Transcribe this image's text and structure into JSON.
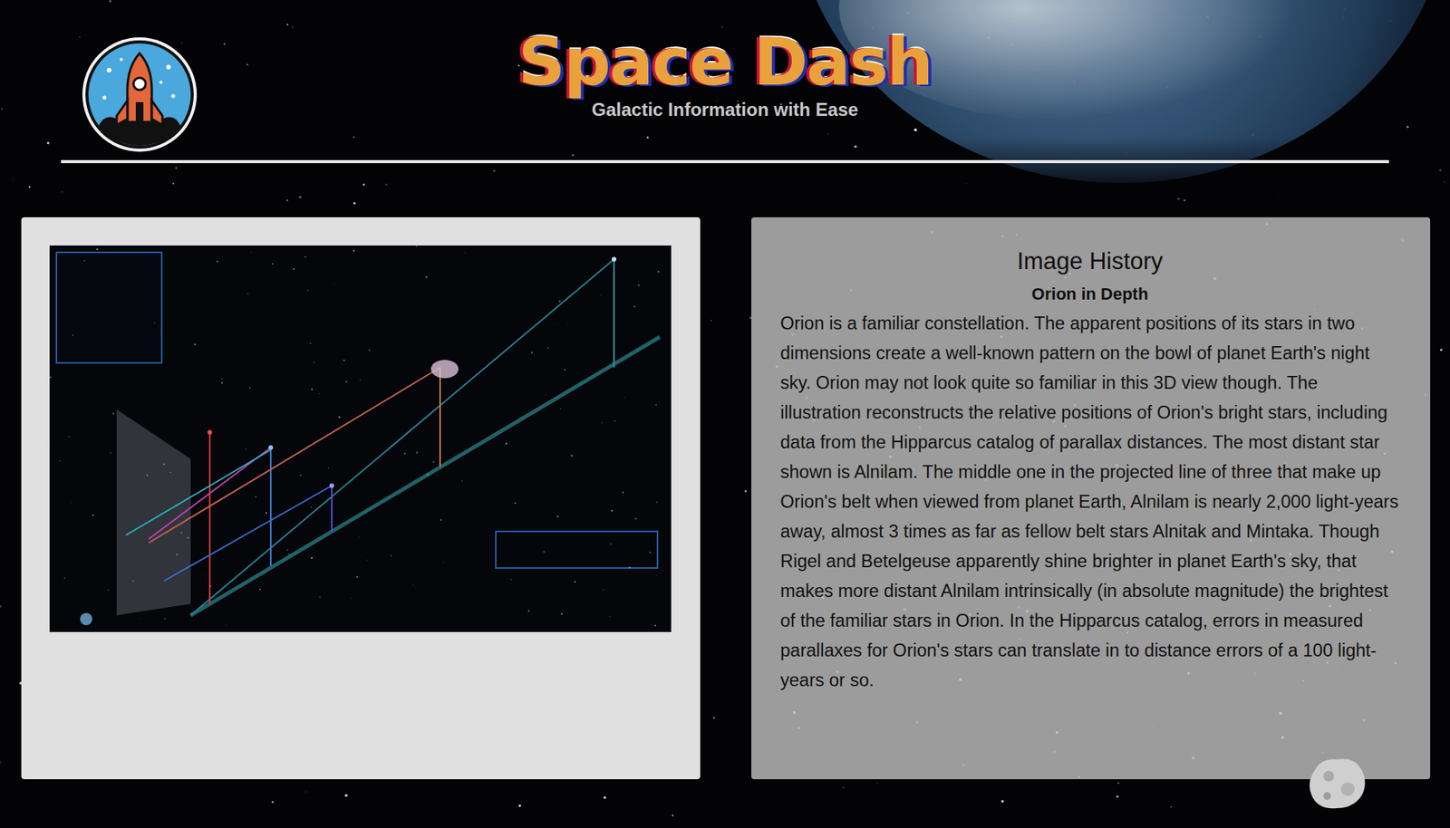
{
  "header": {
    "title": "Space Dash",
    "subtitle": "Galactic Information with Ease"
  },
  "article": {
    "heading": "Image History",
    "subheading": "Orion in Depth",
    "body": "Orion is a familiar constellation. The apparent positions of its stars in two dimensions create a well-known pattern on the bowl of planet Earth's night sky. Orion may not look quite so familiar in this 3D view though. The illustration reconstructs the relative positions of Orion's bright stars, including data from the Hipparcus catalog of parallax distances. The most distant star shown is Alnilam. The middle one in the projected line of three that make up Orion's belt when viewed from planet Earth, Alnilam is nearly 2,000 light-years away, almost 3 times as far as fellow belt stars Alnitak and Mintaka. Though Rigel and Betelgeuse apparently shine brighter in planet Earth's sky, that makes more distant Alnilam intrinsically (in absolute magnitude) the brightest of the familiar stars in Orion. In the Hipparcus catalog, errors in measured parallaxes for Orion's stars can translate in to distance errors of a 100 light-years or so."
  }
}
